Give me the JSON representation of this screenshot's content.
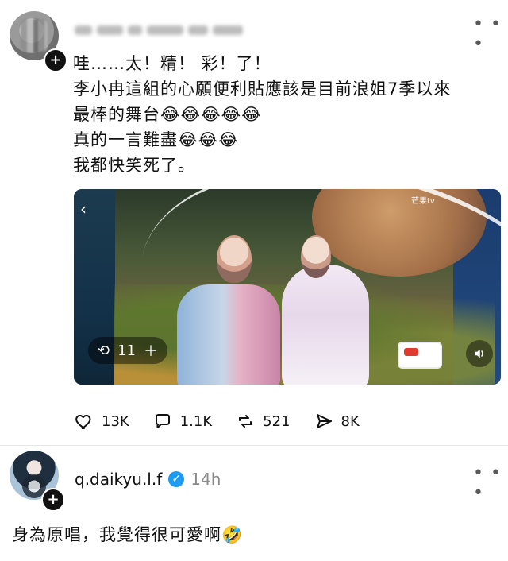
{
  "post1": {
    "more_icon": "more-horizontal-icon",
    "lines": [
      "哇……太！精！ 彩！了！",
      "李小冉這組的心願便利貼應該是目前浪姐7季以來",
      "最棒的舞台😂😂😂😂😂",
      "真的一言難盡😂😂😂",
      "我都快笑死了。"
    ],
    "media": {
      "watermark": "芒果tv",
      "repost_count": "11",
      "back_icon": "chevron-left-icon",
      "mute_icon": "volume-icon",
      "repost_icon": "repost-icon",
      "plus_icon": "plus-icon"
    },
    "actions": {
      "likes": "13K",
      "comments": "1.1K",
      "reposts": "521",
      "shares": "8K"
    }
  },
  "post2": {
    "username": "q.daikyu.l.f",
    "time": "14h",
    "reply": "身為原唱，我覺得很可愛啊🤣",
    "more_icon": "more-horizontal-icon"
  },
  "colors": {
    "verified_blue": "#1d9bf0",
    "text": "#111111",
    "muted": "#8a8a8a"
  }
}
